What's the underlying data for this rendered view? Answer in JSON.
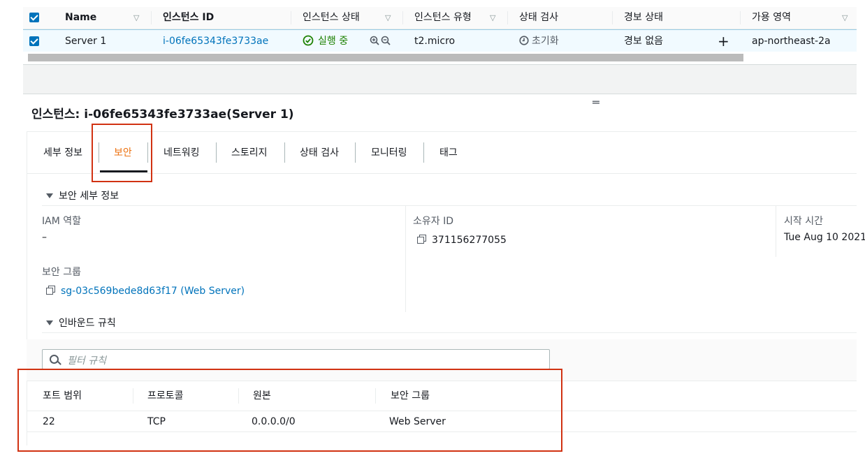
{
  "instance_table": {
    "headers": [
      "Name",
      "인스턴스 ID",
      "인스턴스 상태",
      "인스턴스 유형",
      "상태 검사",
      "경보 상태",
      "가용 영역"
    ],
    "row": {
      "name": "Server 1",
      "instance_id": "i-06fe65343fe3733ae",
      "state": "실행 중",
      "type": "t2.micro",
      "status_check": "초기화",
      "alarm_status": "경보 없음",
      "availability_zone": "ap-northeast-2a"
    }
  },
  "detail": {
    "title_prefix": "인스턴스:",
    "title_value": "i-06fe65343fe3733ae(Server 1)",
    "tabs": [
      "세부 정보",
      "보안",
      "네트워킹",
      "스토리지",
      "상태 검사",
      "모니터링",
      "태그"
    ],
    "active_tab": "보안",
    "security_details_heading": "보안 세부 정보",
    "iam_role_label": "IAM 역할",
    "iam_role_value": "–",
    "owner_id_label": "소유자 ID",
    "owner_id_value": "371156277055",
    "launch_time_label": "시작 시간",
    "launch_time_value": "Tue Aug 10 2021",
    "security_groups_label": "보안 그룹",
    "security_group_value": "sg-03c569bede8d63f17 (Web Server)",
    "inbound_rules_heading": "인바운드 규칙",
    "filter_placeholder": "필터 규칙",
    "rules_headers": [
      "포트 범위",
      "프로토콜",
      "원본",
      "보안 그룹"
    ],
    "rules_rows": [
      [
        "22",
        "TCP",
        "0.0.0.0/0",
        "Web Server"
      ]
    ]
  },
  "icons": [
    "checkbox-icon",
    "filter-caret-icon",
    "running-check-icon",
    "zoom-in-icon",
    "zoom-out-icon",
    "clock-icon",
    "plus-icon",
    "copy-icon",
    "search-icon",
    "drag-handle-icon"
  ],
  "colors": {
    "link": "#0073bb",
    "running": "#1d8102",
    "active_tab": "#ec7211",
    "highlight_box": "#d13212"
  }
}
